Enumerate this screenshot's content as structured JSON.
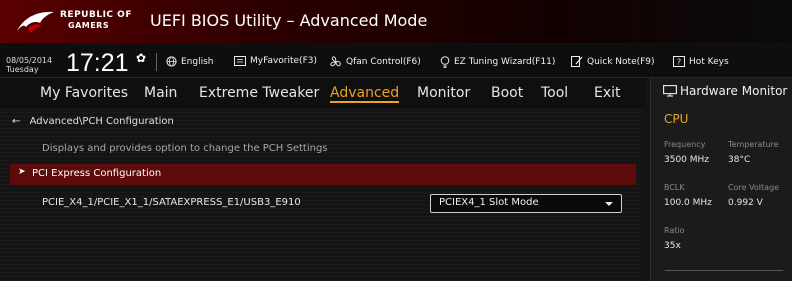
{
  "app": {
    "brand_line1": "REPUBLIC OF",
    "brand_line2": "GAMERS",
    "title": "UEFI BIOS Utility – Advanced Mode"
  },
  "infobar": {
    "date": "08/05/2014",
    "day": "Tuesday",
    "time": "17:21",
    "tools": [
      {
        "label": "English",
        "icon": "globe-icon"
      },
      {
        "label": "MyFavorite(F3)",
        "icon": "favorite-icon"
      },
      {
        "label": "Qfan Control(F6)",
        "icon": "fan-icon"
      },
      {
        "label": "EZ Tuning Wizard(F11)",
        "icon": "bulb-icon"
      },
      {
        "label": "Quick Note(F9)",
        "icon": "note-icon"
      },
      {
        "label": "Hot Keys",
        "icon": "question-icon"
      }
    ]
  },
  "menu": {
    "items": [
      "My Favorites",
      "Main",
      "Extreme Tweaker",
      "Advanced",
      "Monitor",
      "Boot",
      "Tool",
      "Exit"
    ],
    "active": "Advanced"
  },
  "main": {
    "breadcrumb": "Advanced\\PCH Configuration",
    "description": "Displays and provides option to change the PCH Settings",
    "section": "PCI Express Configuration",
    "setting_label": "PCIE_X4_1/PCIE_X1_1/SATAEXPRESS_E1/USB3_E910",
    "setting_value": "PCIEX4_1 Slot Mode"
  },
  "hardware_monitor": {
    "title": "Hardware Monitor",
    "section": "CPU",
    "frequency_label": "Frequency",
    "frequency_value": "3500 MHz",
    "temperature_label": "Temperature",
    "temperature_value": "38°C",
    "bclk_label": "BCLK",
    "bclk_value": "100.0 MHz",
    "core_voltage_label": "Core Voltage",
    "core_voltage_value": "0.992 V",
    "ratio_label": "Ratio",
    "ratio_value": "35x"
  },
  "colors": {
    "accent": "#e8a42c",
    "selected_row": "#5e0b0b",
    "title_red": "#5a0000"
  }
}
